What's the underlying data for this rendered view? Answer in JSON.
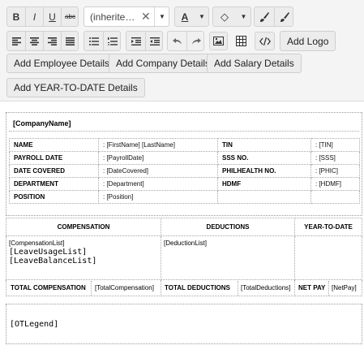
{
  "toolbar": {
    "bold": "B",
    "italic": "I",
    "underline": "U",
    "strike": "abc",
    "font_value": "(inherite…",
    "font_clear": "✕",
    "dropdown_arrow": "▼",
    "text_color": "A",
    "fill_color": "◇",
    "add_logo": "Add Logo",
    "add_employee": "Add Employee Details",
    "add_company": "Add Company Details",
    "add_salary": "Add Salary Details",
    "add_ytd": "Add YEAR-TO-DATE Details"
  },
  "document": {
    "company": "[CompanyName]",
    "fields": [
      {
        "label": "NAME",
        "value": ": [FirstName] [LastName]",
        "label2": "TIN",
        "value2": ": [TIN]"
      },
      {
        "label": "PAYROLL DATE",
        "value": ": [PayrollDate]",
        "label2": "SSS NO.",
        "value2": ": [SSS]"
      },
      {
        "label": "DATE COVERED",
        "value": ": [DateCovered]",
        "label2": "PHILHEALTH NO.",
        "value2": ": [PHIC]"
      },
      {
        "label": "DEPARTMENT",
        "value": ": [Department]",
        "label2": "HDMF",
        "value2": ": [HDMF]"
      },
      {
        "label": "POSITION",
        "value": ": [Position]",
        "label2": "",
        "value2": ""
      }
    ],
    "compensation_header": "COMPENSATION",
    "deductions_header": "DEDUCTIONS",
    "ytd_header": "YEAR-TO-DATE",
    "compensation_list": "[CompensationList]",
    "leave_usage": "[LeaveUsageList]",
    "leave_balance": "[LeaveBalanceList]",
    "deduction_list": "[DeductionList]",
    "total_comp_label": "TOTAL COMPENSATION",
    "total_comp_value": "[TotalCompensation]",
    "total_ded_label": "TOTAL DEDUCTIONS",
    "total_ded_value": "[TotalDeductions]",
    "net_pay_label": "NET PAY",
    "net_pay_value": "[NetPay]",
    "ot_legend": "[OTLegend]"
  }
}
